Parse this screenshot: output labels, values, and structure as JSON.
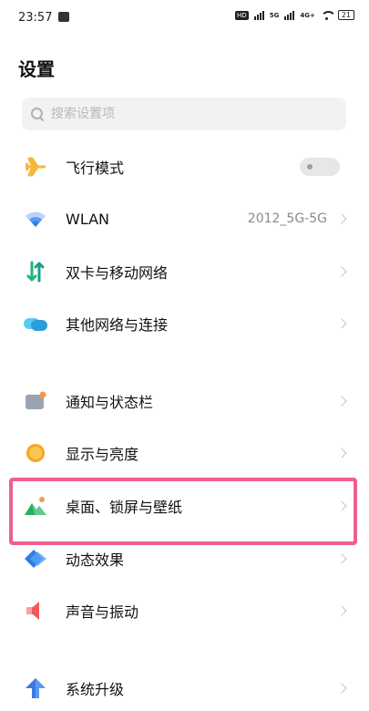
{
  "status_bar": {
    "time": "23:57",
    "hd_label": "HD",
    "sim1_type": "5G",
    "sim2_type": "4G+",
    "battery": "21"
  },
  "page": {
    "title": "设置"
  },
  "search": {
    "placeholder": "搜索设置项"
  },
  "settings": [
    {
      "id": "airplane",
      "label": "飞行模式",
      "icon": "airplane-icon",
      "toggle": "off"
    },
    {
      "id": "wlan",
      "label": "WLAN",
      "icon": "wifi-icon",
      "value": "2012_5G-5G"
    },
    {
      "id": "dual-sim",
      "label": "双卡与移动网络",
      "icon": "dual-sim-icon"
    },
    {
      "id": "other-networks",
      "label": "其他网络与连接",
      "icon": "cloud-icon"
    },
    {
      "id": "notifications",
      "label": "通知与状态栏",
      "icon": "notification-icon"
    },
    {
      "id": "display",
      "label": "显示与亮度",
      "icon": "sun-icon"
    },
    {
      "id": "wallpaper",
      "label": "桌面、锁屏与壁纸",
      "icon": "landscape-icon"
    },
    {
      "id": "dynamic-effects",
      "label": "动态效果",
      "icon": "diamond-icon"
    },
    {
      "id": "sound",
      "label": "声音与振动",
      "icon": "speaker-icon"
    },
    {
      "id": "system-upgrade",
      "label": "系统升级",
      "icon": "arrow-up-icon"
    }
  ],
  "colors": {
    "highlight": "#ee5f92",
    "airplane": "#f5b73b",
    "wifi": "#2f80ed",
    "dual_sim": "#22b573",
    "cloud": "#2d9cdb",
    "sun": "#f6a623",
    "diamond": "#2f7de1",
    "speaker": "#ef5b5b",
    "arrow_up": "#3b7ae0"
  }
}
